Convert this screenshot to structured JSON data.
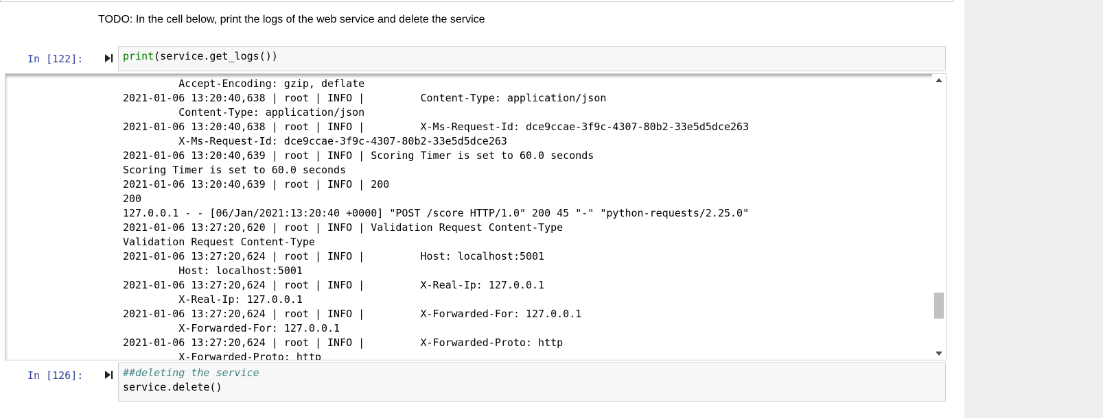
{
  "markdown": {
    "text": "TODO: In the cell below, print the logs of the web service and delete the service"
  },
  "cells": [
    {
      "prompt": "In [122]:",
      "code_builtin": "print",
      "code_rest": "(service.get_logs())"
    },
    {
      "prompt": "In [126]:",
      "code_comment": "##deleting the service",
      "code_line2": "service.delete()"
    }
  ],
  "output": {
    "lines": [
      "         Accept-Encoding: gzip, deflate",
      "2021-01-06 13:20:40,638 | root | INFO |         Content-Type: application/json",
      "         Content-Type: application/json",
      "2021-01-06 13:20:40,638 | root | INFO |         X-Ms-Request-Id: dce9ccae-3f9c-4307-80b2-33e5d5dce263",
      "         X-Ms-Request-Id: dce9ccae-3f9c-4307-80b2-33e5d5dce263",
      "2021-01-06 13:20:40,639 | root | INFO | Scoring Timer is set to 60.0 seconds",
      "Scoring Timer is set to 60.0 seconds",
      "2021-01-06 13:20:40,639 | root | INFO | 200",
      "200",
      "127.0.0.1 - - [06/Jan/2021:13:20:40 +0000] \"POST /score HTTP/1.0\" 200 45 \"-\" \"python-requests/2.25.0\"",
      "2021-01-06 13:27:20,620 | root | INFO | Validation Request Content-Type",
      "Validation Request Content-Type",
      "2021-01-06 13:27:20,624 | root | INFO |         Host: localhost:5001",
      "         Host: localhost:5001",
      "2021-01-06 13:27:20,624 | root | INFO |         X-Real-Ip: 127.0.0.1",
      "         X-Real-Ip: 127.0.0.1",
      "2021-01-06 13:27:20,624 | root | INFO |         X-Forwarded-For: 127.0.0.1",
      "         X-Forwarded-For: 127.0.0.1",
      "2021-01-06 13:27:20,624 | root | INFO |         X-Forwarded-Proto: http",
      "         X-Forwarded-Proto: http"
    ],
    "scroll_position": 0.76
  },
  "icons": {
    "run": "run-cell-icon",
    "scroll_up": "triangle-up-icon",
    "scroll_down": "triangle-down-icon"
  },
  "colors": {
    "prompt": "#303f9f",
    "builtin": "#008000",
    "comment": "#408080",
    "selection_bar": "#42a5f5"
  }
}
